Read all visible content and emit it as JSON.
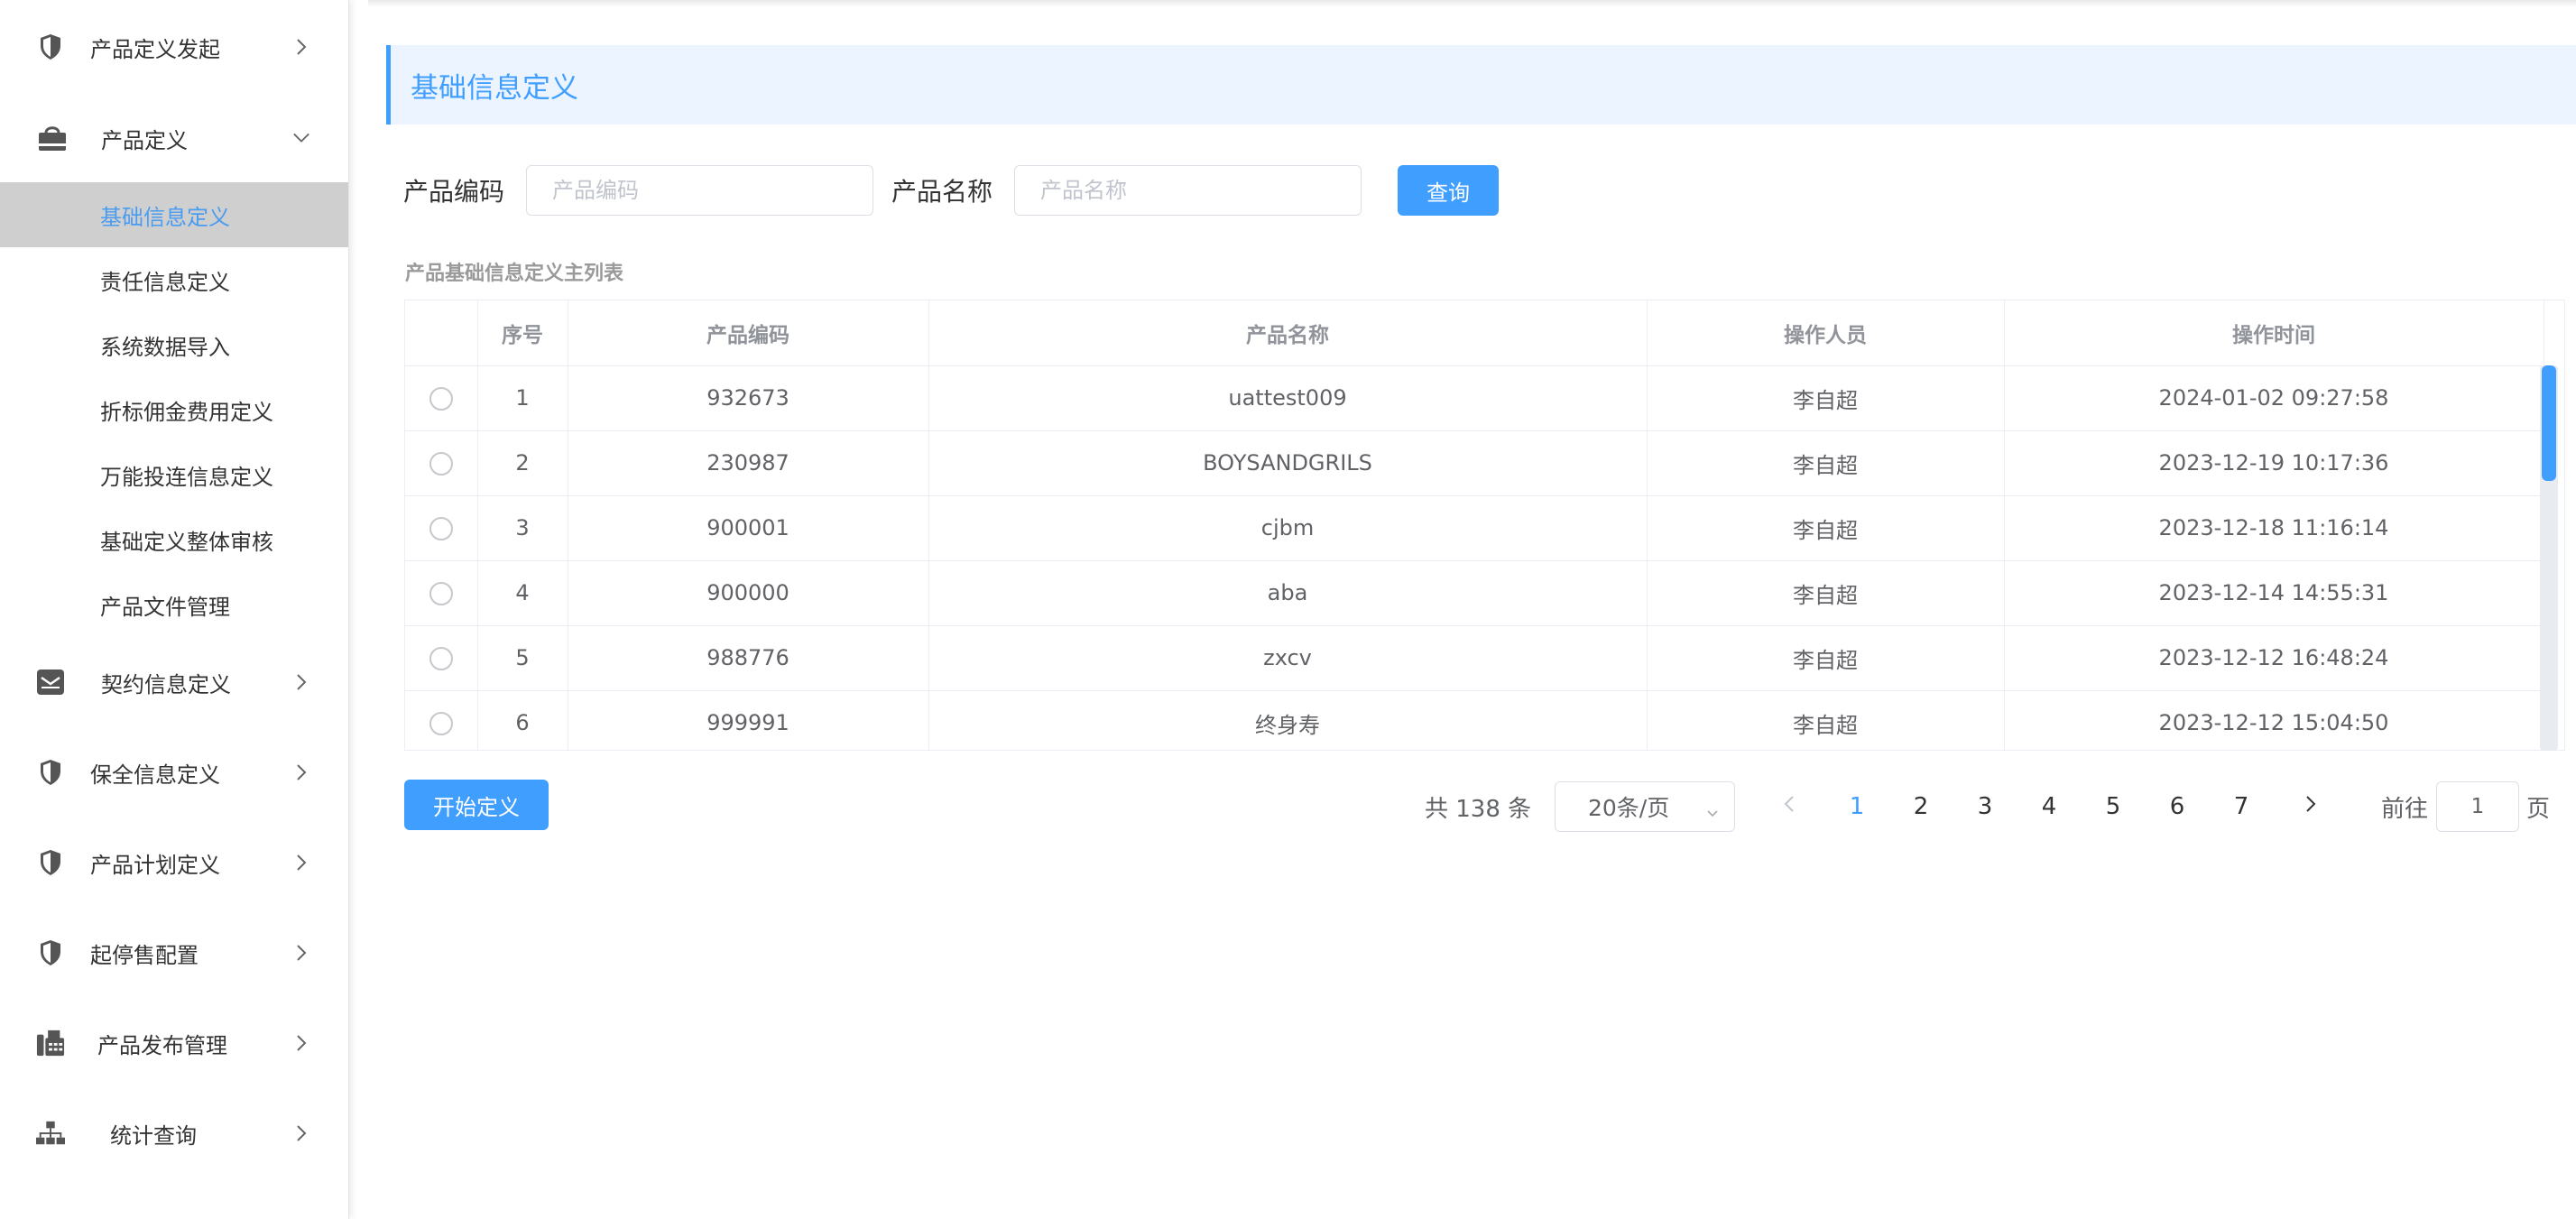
{
  "sidebar": {
    "items": [
      {
        "label": "产品定义发起",
        "icon": "shield-icon",
        "expanded": false
      },
      {
        "label": "产品定义",
        "icon": "shopping-bag-icon",
        "expanded": true
      },
      {
        "label": "契约信息定义",
        "icon": "envelope-icon",
        "expanded": false
      },
      {
        "label": "保全信息定义",
        "icon": "shield-icon",
        "expanded": false
      },
      {
        "label": "产品计划定义",
        "icon": "shield-icon",
        "expanded": false
      },
      {
        "label": "起停售配置",
        "icon": "shield-icon",
        "expanded": false
      },
      {
        "label": "产品发布管理",
        "icon": "fax-icon",
        "expanded": false
      },
      {
        "label": "统计查询",
        "icon": "sitemap-icon",
        "expanded": false
      }
    ],
    "submenu": [
      {
        "label": "基础信息定义",
        "active": true
      },
      {
        "label": "责任信息定义",
        "active": false
      },
      {
        "label": "系统数据导入",
        "active": false
      },
      {
        "label": "折标佣金费用定义",
        "active": false
      },
      {
        "label": "万能投连信息定义",
        "active": false
      },
      {
        "label": "基础定义整体审核",
        "active": false
      },
      {
        "label": "产品文件管理",
        "active": false
      }
    ]
  },
  "page": {
    "title": "基础信息定义"
  },
  "search": {
    "code_label": "产品编码",
    "code_placeholder": "产品编码",
    "name_label": "产品名称",
    "name_placeholder": "产品名称",
    "query_button": "查询"
  },
  "table": {
    "caption": "产品基础信息定义主列表",
    "columns": [
      "",
      "序号",
      "产品编码",
      "产品名称",
      "操作人员",
      "操作时间"
    ],
    "rows": [
      {
        "index": "1",
        "code": "932673",
        "name": "uattest009",
        "operator": "李自超",
        "time": "2024-01-02 09:27:58"
      },
      {
        "index": "2",
        "code": "230987",
        "name": "BOYSANDGRILS",
        "operator": "李自超",
        "time": "2023-12-19 10:17:36"
      },
      {
        "index": "3",
        "code": "900001",
        "name": "cjbm",
        "operator": "李自超",
        "time": "2023-12-18 11:16:14"
      },
      {
        "index": "4",
        "code": "900000",
        "name": "aba",
        "operator": "李自超",
        "time": "2023-12-14 14:55:31"
      },
      {
        "index": "5",
        "code": "988776",
        "name": "zxcv",
        "operator": "李自超",
        "time": "2023-12-12 16:48:24"
      },
      {
        "index": "6",
        "code": "999991",
        "name": "终身寿",
        "operator": "李自超",
        "time": "2023-12-12 15:04:50"
      }
    ]
  },
  "actions": {
    "start_button": "开始定义"
  },
  "pagination": {
    "total": "共 138 条",
    "page_size": "20条/页",
    "pages": [
      "1",
      "2",
      "3",
      "4",
      "5",
      "6",
      "7"
    ],
    "current_page": "1",
    "goto_prefix": "前往",
    "goto_value": "1",
    "goto_suffix": "页"
  },
  "colors": {
    "primary": "#409eff",
    "active_menu_bg": "#cfcfcf",
    "title_bar_bg": "#ecf5ff"
  }
}
